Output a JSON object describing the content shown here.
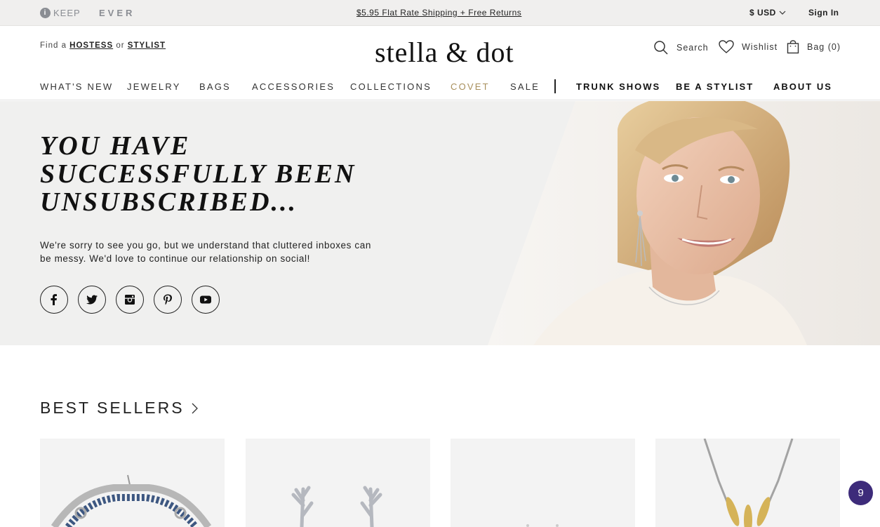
{
  "topbar": {
    "keep_badge": "i",
    "keep_label": "KEEP",
    "ever_label": "EVER",
    "promo": "$5.95 Flat Rate Shipping + Free Returns",
    "currency": "$ USD",
    "sign_in": "Sign In"
  },
  "header": {
    "finder_prefix": "Find a",
    "finder_hostess": "HOSTESS",
    "finder_or": "or",
    "finder_stylist": "STYLIST",
    "logo": "stella & dot",
    "search_label": "Search",
    "wishlist_label": "Wishlist",
    "bag_label": "Bag (0)"
  },
  "nav": {
    "items": [
      "WHAT'S NEW",
      "JEWELRY",
      "BAGS",
      "ACCESSORIES",
      "COLLECTIONS",
      "COVET",
      "SALE",
      "TRUNK SHOWS",
      "BE A STYLIST",
      "ABOUT US"
    ]
  },
  "hero": {
    "title_lines": [
      "YOU HAVE",
      "SUCCESSFULLY BEEN",
      "UNSUBSCRIBED..."
    ],
    "message": "We're sorry to see you go, but we understand that cluttered inboxes can be messy. We'd love to continue our relationship on social!",
    "socials": [
      "facebook-icon",
      "twitter-icon",
      "instagram-icon",
      "pinterest-icon",
      "youtube-icon"
    ]
  },
  "best_sellers": {
    "title": "BEST SELLERS"
  },
  "chat_badge": "9",
  "colors": {
    "covet_gold": "#a88f5c",
    "hero_bg": "#f0f0ef",
    "chat_purple": "#3d2b7a"
  }
}
